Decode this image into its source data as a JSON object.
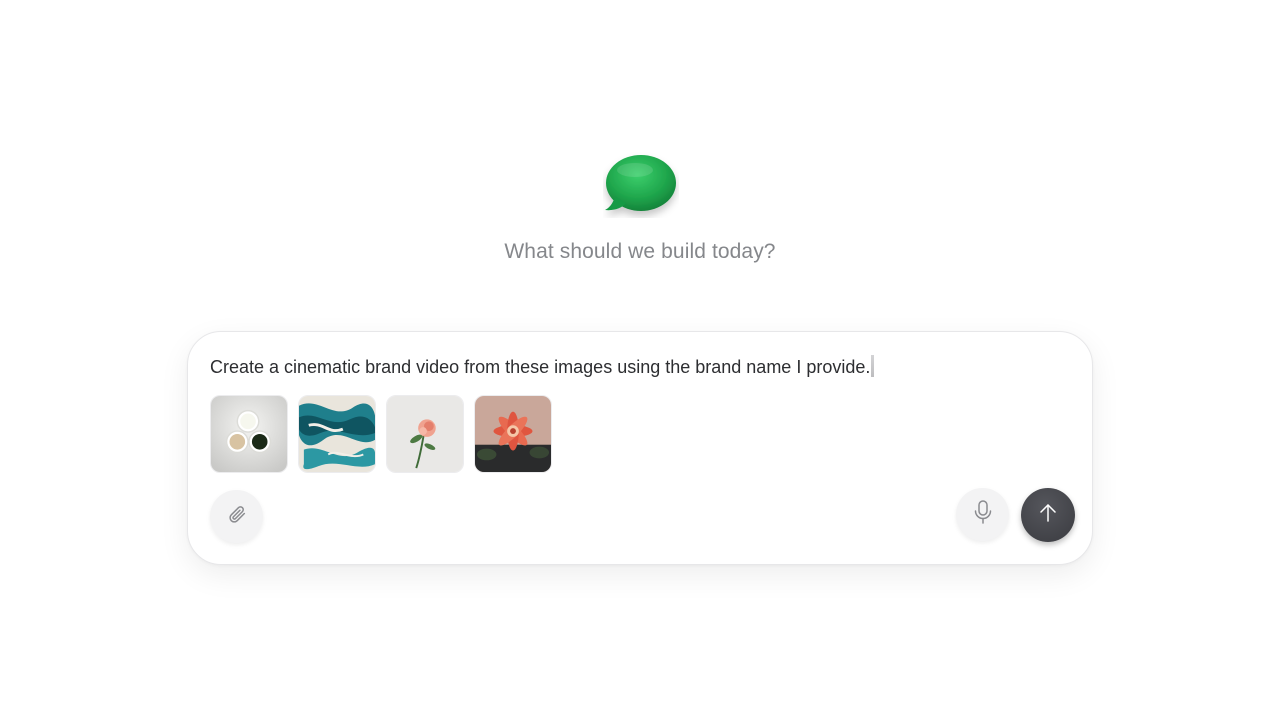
{
  "brand": {
    "logo_icon": "speech-bubble-icon",
    "accent": "#22a14d"
  },
  "headline": "What should we build today?",
  "composer": {
    "prompt_text": "Create a cinematic brand video from these images using the brand name I provide.",
    "attachments": [
      {
        "name": "coffee-cups-image"
      },
      {
        "name": "teal-marble-image"
      },
      {
        "name": "pink-rose-image"
      },
      {
        "name": "red-flower-image"
      }
    ],
    "attach_icon": "paperclip-icon",
    "mic_icon": "microphone-icon",
    "send_icon": "arrow-up-icon",
    "send_color": "#46474c"
  }
}
